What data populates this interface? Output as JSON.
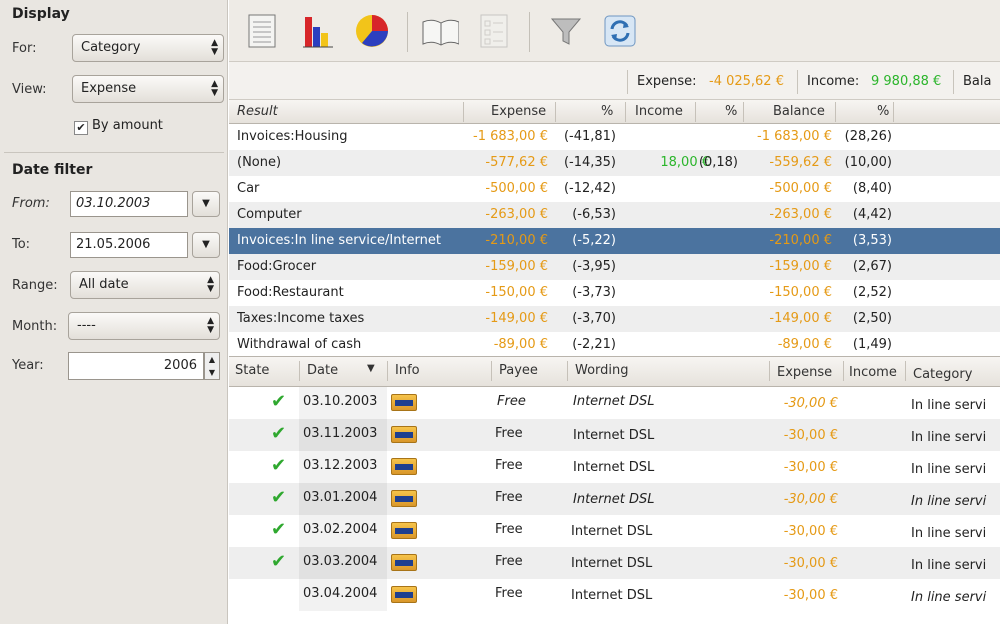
{
  "display": {
    "title": "Display",
    "for_label": "For:",
    "for_value": "Category",
    "view_label": "View:",
    "view_value": "Expense",
    "by_amount_label": "By amount"
  },
  "date_filter": {
    "title": "Date filter",
    "from_label": "From:",
    "from_value": "03.10.2003",
    "to_label": "To:",
    "to_value": "21.05.2006",
    "range_label": "Range:",
    "range_value": "All date",
    "month_label": "Month:",
    "month_value": "----",
    "year_label": "Year:",
    "year_value": "2006"
  },
  "summary": {
    "expense_label": "Expense:",
    "expense_value": "-4 025,62 €",
    "income_label": "Income:",
    "income_value": "9 980,88 €",
    "balance_label": "Bala"
  },
  "result": {
    "headers": [
      "Result",
      "Expense",
      "%",
      "Income",
      "%",
      "Balance",
      "%"
    ],
    "rows": [
      {
        "name": "Invoices:Housing",
        "expense": "-1 683,00 €",
        "exp_pct": "(-41,81)",
        "income": "",
        "inc_pct": "",
        "balance": "-1 683,00 €",
        "bal_pct": "(28,26)"
      },
      {
        "name": "(None)",
        "expense": "-577,62 €",
        "exp_pct": "(-14,35)",
        "income": "18,00 €",
        "inc_pct": "(0,18)",
        "balance": "-559,62 €",
        "bal_pct": "(10,00)"
      },
      {
        "name": "Car",
        "expense": "-500,00 €",
        "exp_pct": "(-12,42)",
        "income": "",
        "inc_pct": "",
        "balance": "-500,00 €",
        "bal_pct": "(8,40)"
      },
      {
        "name": "Computer",
        "expense": "-263,00 €",
        "exp_pct": "(-6,53)",
        "income": "",
        "inc_pct": "",
        "balance": "-263,00 €",
        "bal_pct": "(4,42)"
      },
      {
        "name": "Invoices:In line service/Internet",
        "expense": "-210,00 €",
        "exp_pct": "(-5,22)",
        "income": "",
        "inc_pct": "",
        "balance": "-210,00 €",
        "bal_pct": "(3,53)"
      },
      {
        "name": "Food:Grocer",
        "expense": "-159,00 €",
        "exp_pct": "(-3,95)",
        "income": "",
        "inc_pct": "",
        "balance": "-159,00 €",
        "bal_pct": "(2,67)"
      },
      {
        "name": "Food:Restaurant",
        "expense": "-150,00 €",
        "exp_pct": "(-3,73)",
        "income": "",
        "inc_pct": "",
        "balance": "-150,00 €",
        "bal_pct": "(2,52)"
      },
      {
        "name": "Taxes:Income taxes",
        "expense": "-149,00 €",
        "exp_pct": "(-3,70)",
        "income": "",
        "inc_pct": "",
        "balance": "-149,00 €",
        "bal_pct": "(2,50)"
      },
      {
        "name": "Withdrawal of cash",
        "expense": "-89,00 €",
        "exp_pct": "(-2,21)",
        "income": "",
        "inc_pct": "",
        "balance": "-89,00 €",
        "bal_pct": "(1,49)"
      }
    ]
  },
  "transactions": {
    "headers": [
      "State",
      "Date",
      "Info",
      "Payee",
      "Wording",
      "Expense",
      "Income",
      "Category"
    ],
    "rows": [
      {
        "checked": true,
        "date": "03.10.2003",
        "payee": "Free",
        "wording": "Internet DSL",
        "expense": "-30,00 €",
        "income": "",
        "category": "In line servi"
      },
      {
        "checked": true,
        "date": "03.11.2003",
        "payee": "Free",
        "wording": "Internet DSL",
        "expense": "-30,00 €",
        "income": "",
        "category": "In line servi"
      },
      {
        "checked": true,
        "date": "03.12.2003",
        "payee": "Free",
        "wording": "Internet DSL",
        "expense": "-30,00 €",
        "income": "",
        "category": "In line servi"
      },
      {
        "checked": true,
        "date": "03.01.2004",
        "payee": "Free",
        "wording": "Internet DSL",
        "expense": "-30,00 €",
        "income": "",
        "category": "In line servi"
      },
      {
        "checked": true,
        "date": "03.02.2004",
        "payee": "Free",
        "wording": "Internet DSL",
        "expense": "-30,00 €",
        "income": "",
        "category": "In line servi"
      },
      {
        "checked": true,
        "date": "03.03.2004",
        "payee": "Free",
        "wording": "Internet DSL",
        "expense": "-30,00 €",
        "income": "",
        "category": "In line servi"
      },
      {
        "checked": false,
        "date": "03.04.2004",
        "payee": "Free",
        "wording": "Internet DSL",
        "expense": "-30,00 €",
        "income": "",
        "category": "In line servi"
      }
    ]
  },
  "colors": {
    "expense": "#e59a16",
    "income": "#2bb52b",
    "selection": "#4b739f"
  },
  "icons": [
    "list-report-icon",
    "bar-chart-icon",
    "pie-chart-icon",
    "book-icon",
    "checklist-icon",
    "filter-icon",
    "refresh-icon"
  ]
}
